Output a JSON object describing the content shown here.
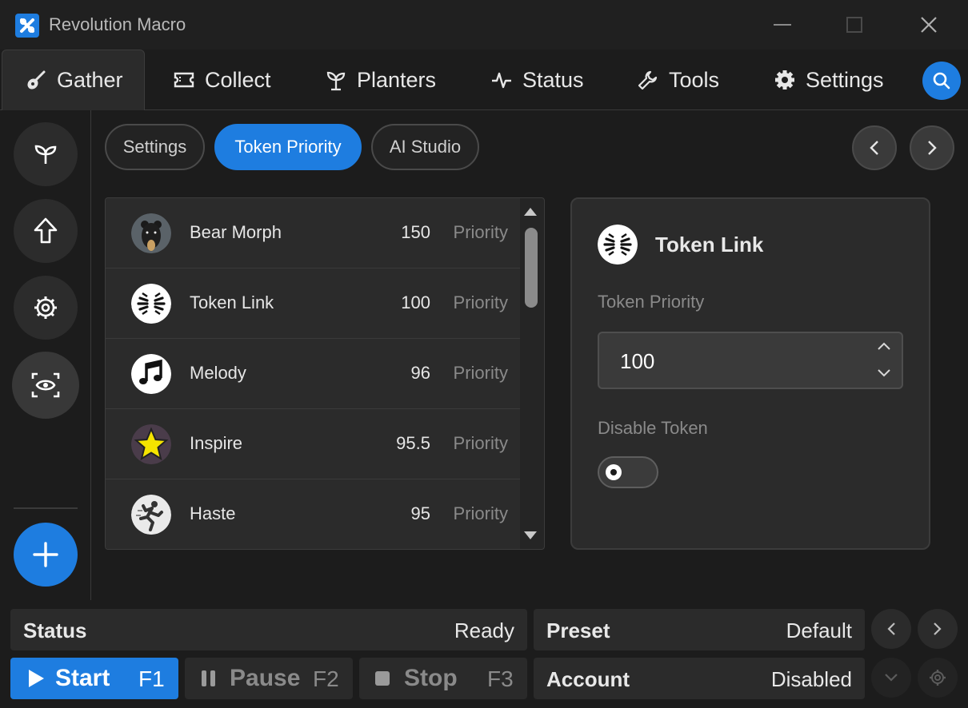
{
  "window": {
    "title": "Revolution Macro",
    "controls": [
      "minimize",
      "maximize",
      "close"
    ]
  },
  "tabs": [
    {
      "label": "Gather",
      "icon": "guitar-icon",
      "active": true
    },
    {
      "label": "Collect",
      "icon": "ticket-icon",
      "active": false
    },
    {
      "label": "Planters",
      "icon": "sprout-icon",
      "active": false
    },
    {
      "label": "Status",
      "icon": "pulse-icon",
      "active": false
    },
    {
      "label": "Tools",
      "icon": "wrench-icon",
      "active": false
    },
    {
      "label": "Settings",
      "icon": "gear-icon",
      "active": false
    }
  ],
  "sidebar": {
    "buttons": [
      "sprout-icon",
      "arrow-up-icon",
      "gear-icon",
      "eye-scan-icon"
    ],
    "active_index": 3,
    "add_icon": "plus-icon"
  },
  "subtabs": [
    {
      "label": "Settings",
      "active": false
    },
    {
      "label": "Token Priority",
      "active": true
    },
    {
      "label": "AI Studio",
      "active": false
    }
  ],
  "list": {
    "priority_label": "Priority",
    "rows": [
      {
        "name": "Bear Morph",
        "value": "150",
        "icon": "bear-morph-icon"
      },
      {
        "name": "Token Link",
        "value": "100",
        "icon": "token-link-icon"
      },
      {
        "name": "Melody",
        "value": "96",
        "icon": "music-note-icon"
      },
      {
        "name": "Inspire",
        "value": "95.5",
        "icon": "star-icon"
      },
      {
        "name": "Haste",
        "value": "95",
        "icon": "running-man-icon"
      }
    ]
  },
  "detail": {
    "title": "Token Link",
    "priority_label": "Token Priority",
    "priority_value": "100",
    "disable_label": "Disable Token",
    "disabled": false
  },
  "footer": {
    "status_label": "Status",
    "status_value": "Ready",
    "preset_label": "Preset",
    "preset_value": "Default",
    "account_label": "Account",
    "account_value": "Disabled",
    "start_label": "Start",
    "start_key": "F1",
    "pause_label": "Pause",
    "pause_key": "F2",
    "stop_label": "Stop",
    "stop_key": "F3"
  },
  "colors": {
    "accent": "#1e7de0",
    "background": "#1c1c1c",
    "panel": "#2b2b2b"
  }
}
